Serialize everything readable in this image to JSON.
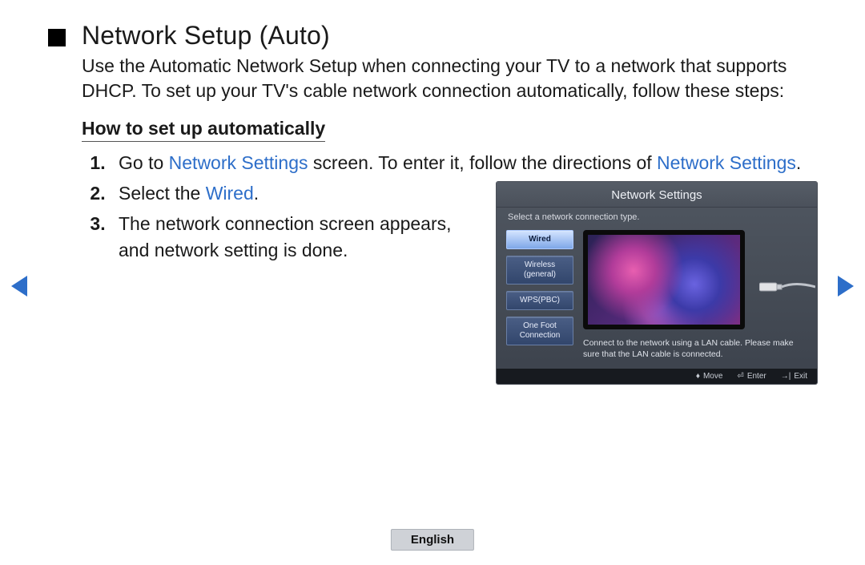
{
  "title": "Network Setup (Auto)",
  "intro": "Use the Automatic Network Setup when connecting your TV to a network that supports DHCP. To set up your TV's cable network connection automatically, follow these steps:",
  "subhead": "How to set up automatically",
  "steps": {
    "s1_a": "Go to ",
    "s1_link1": "Network Settings",
    "s1_b": " screen. To enter it, follow the directions of ",
    "s1_link2": "Network Settings",
    "s1_c": ".",
    "s2_a": "Select the ",
    "s2_link": "Wired",
    "s2_b": ".",
    "s3": "The network connection screen appears, and network setting is done."
  },
  "osd": {
    "title": "Network Settings",
    "subtitle": "Select a network connection type.",
    "options": {
      "wired": "Wired",
      "wireless": "Wireless (general)",
      "wps": "WPS(PBC)",
      "onefoot": "One Foot Connection"
    },
    "description": "Connect to the network using a LAN cable. Please make sure that the LAN cable is connected.",
    "footer": {
      "move": "Move",
      "enter": "Enter",
      "exit": "Exit"
    }
  },
  "language": "English"
}
